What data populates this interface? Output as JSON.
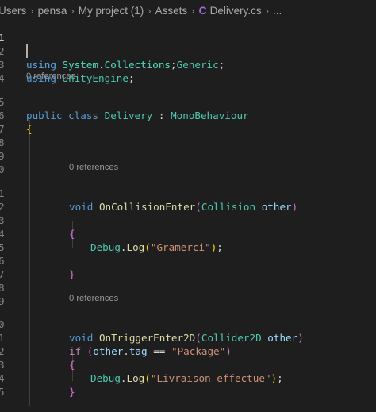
{
  "breadcrumb": {
    "items": [
      "Users",
      "pensa",
      "My project (1)",
      "Assets",
      "Delivery.cs",
      "..."
    ],
    "file_icon": "csharp-file-icon"
  },
  "codelens": {
    "class_refs": "0 references",
    "collision_refs": "0 references",
    "trigger_refs": "0 references"
  },
  "line_numbers": {
    "l1": "1",
    "l2": "2",
    "l3": "3",
    "l4": "4",
    "l5": "5",
    "l6": "6",
    "l7": "7",
    "l8": "8",
    "l9": "9",
    "l10": "0",
    "l11": "1",
    "l12": "2",
    "l13": "3",
    "l14": "4",
    "l15": "5",
    "l16": "6",
    "l17": "7",
    "l18": "8",
    "l19": "9",
    "l20": "0",
    "l21": "1",
    "l22": "2",
    "l23": "3",
    "l24": "4",
    "l25": "5"
  },
  "code": {
    "l1": {
      "kw": "using",
      "ns": "System",
      "dot": ".",
      "ns2": "Collections",
      "end": ";"
    },
    "l2": {
      "kw": "using",
      "ns": "System",
      "dot": ".",
      "ns2": "Collections",
      "dot2": ".",
      "ns3": "Generic",
      "end": ";"
    },
    "l3": {
      "kw": "using",
      "ns": "UnityEngine",
      "end": ";"
    },
    "l5": {
      "kw1": "public",
      "kw2": "class",
      "name": "Delivery",
      "colon": ":",
      "base": "MonoBehaviour"
    },
    "l6": {
      "brace": "{"
    },
    "l11": {
      "kw": "void",
      "fn": "OnCollisionEnter",
      "open": "(",
      "type": "Collision",
      "param": "other",
      "close": ")"
    },
    "l13": {
      "brace": "{"
    },
    "l14": {
      "cls": "Debug",
      "dot": ".",
      "fn": "Log",
      "open": "(",
      "str": "\"Gramerci\"",
      "close": ")",
      "end": ";"
    },
    "l16": {
      "brace": "}"
    },
    "l20": {
      "kw": "void",
      "fn": "OnTriggerEnter2D",
      "open": "(",
      "type": "Collider2D",
      "param": "other",
      "close": ")"
    },
    "l21": {
      "kw": "if",
      "open": "(",
      "obj": "other",
      "dot": ".",
      "prop": "tag",
      "op": "==",
      "str": "\"Package\"",
      "close": ")"
    },
    "l22": {
      "brace": "{"
    },
    "l23": {
      "cls": "Debug",
      "dot": ".",
      "fn": "Log",
      "open": "(",
      "str": "\"Livraison effectue\"",
      "close": ")",
      "end": ";"
    },
    "l24": {
      "brace": "}"
    }
  },
  "colors": {
    "background": "#1e1e1e",
    "keyword": "#569cd6",
    "type": "#4ec9b0",
    "function": "#dcdcaa",
    "string": "#ce9178",
    "variable": "#9cdcfe",
    "control": "#c586c0",
    "bracket_level1": "#ffd700",
    "bracket_level2": "#da70d6"
  }
}
